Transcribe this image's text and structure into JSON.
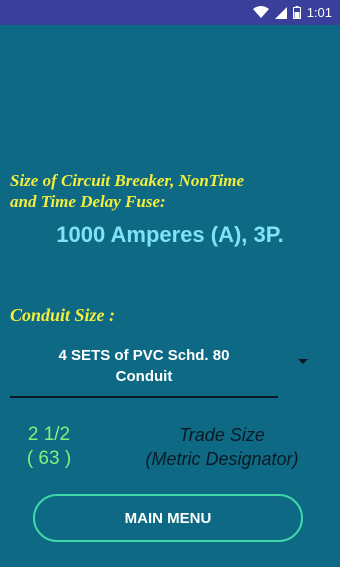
{
  "status_bar": {
    "time": "1:01",
    "icons": [
      "wifi-icon",
      "signal-icon",
      "battery-icon"
    ]
  },
  "breaker": {
    "title_line1": "Size of Circuit Breaker, NonTime",
    "title_line2": "and Time Delay Fuse:",
    "value": "1000 Amperes (A), 3P."
  },
  "conduit": {
    "title": "Conduit Size :",
    "selected_line1": "4 SETS of   PVC Schd. 80",
    "selected_line2": "Conduit"
  },
  "size": {
    "trade_size": "2 1/2",
    "metric_designator": "( 63 )",
    "trade_size_label": "Trade Size",
    "metric_label": "(Metric Designator)"
  },
  "actions": {
    "main_menu_label": "MAIN MENU"
  },
  "colors": {
    "background": "#0e6a84",
    "status_bar": "#3a3f9c",
    "title_yellow": "#f4ee3a",
    "value_cyan": "#7ee3f4",
    "size_green": "#84f07c",
    "button_border": "#3fd6a8"
  }
}
